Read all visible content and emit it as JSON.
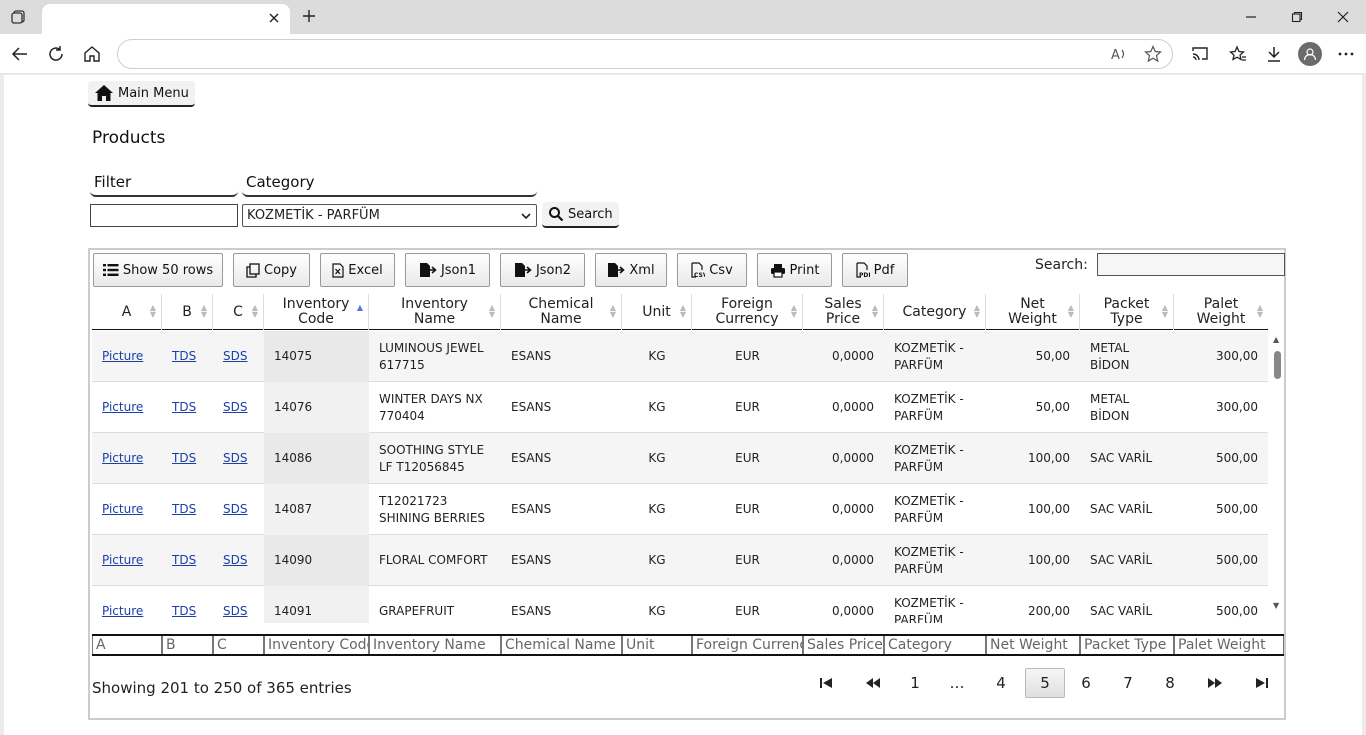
{
  "browser": {
    "tab_title": "",
    "url": ""
  },
  "page": {
    "main_menu_label": "Main Menu",
    "title": "Products",
    "filter_label": "Filter",
    "filter_value": "",
    "category_label": "Category",
    "category_value": "KOZMETİK - PARFÜM",
    "search_button_label": "Search"
  },
  "datatable": {
    "buttons": [
      "Show 50 rows",
      "Copy",
      "Excel",
      "Json1",
      "Json2",
      "Xml",
      "Csv",
      "Print",
      "Pdf"
    ],
    "search_label": "Search:",
    "search_value": "",
    "columns": [
      "A",
      "B",
      "C",
      "Inventory Code",
      "Inventory Name",
      "Chemical Name",
      "Unit",
      "Foreign Currency",
      "Sales Price",
      "Category",
      "Net Weight",
      "Packet Type",
      "Palet Weight"
    ],
    "header_lines": [
      [
        "A"
      ],
      [
        "B"
      ],
      [
        "C"
      ],
      [
        "Inventory",
        "Code"
      ],
      [
        "Inventory",
        "Name"
      ],
      [
        "Chemical",
        "Name"
      ],
      [
        "Unit"
      ],
      [
        "Foreign",
        "Currency"
      ],
      [
        "Sales",
        "Price"
      ],
      [
        "Category"
      ],
      [
        "Net",
        "Weight"
      ],
      [
        "Packet",
        "Type"
      ],
      [
        "Palet",
        "Weight"
      ]
    ],
    "sorted_column": "Inventory Code",
    "rows": [
      {
        "a": "Picture",
        "b": "TDS",
        "c": "SDS",
        "code": "14075",
        "name": "LUMINOUS JEWEL 617715",
        "chemical": "ESANS",
        "unit": "KG",
        "currency": "EUR",
        "price": "0,0000",
        "category": "KOZMETİK - PARFÜM",
        "net_weight": "50,00",
        "packet": "METAL BİDON",
        "palet_weight": "300,00"
      },
      {
        "a": "Picture",
        "b": "TDS",
        "c": "SDS",
        "code": "14076",
        "name": "WINTER DAYS NX 770404",
        "chemical": "ESANS",
        "unit": "KG",
        "currency": "EUR",
        "price": "0,0000",
        "category": "KOZMETİK - PARFÜM",
        "net_weight": "50,00",
        "packet": "METAL BİDON",
        "palet_weight": "300,00"
      },
      {
        "a": "Picture",
        "b": "TDS",
        "c": "SDS",
        "code": "14086",
        "name": "SOOTHING STYLE LF T12056845",
        "chemical": "ESANS",
        "unit": "KG",
        "currency": "EUR",
        "price": "0,0000",
        "category": "KOZMETİK - PARFÜM",
        "net_weight": "100,00",
        "packet": "SAC VARİL",
        "palet_weight": "500,00"
      },
      {
        "a": "Picture",
        "b": "TDS",
        "c": "SDS",
        "code": "14087",
        "name": "T12021723 SHINING BERRIES",
        "chemical": "ESANS",
        "unit": "KG",
        "currency": "EUR",
        "price": "0,0000",
        "category": "KOZMETİK - PARFÜM",
        "net_weight": "100,00",
        "packet": "SAC VARİL",
        "palet_weight": "500,00"
      },
      {
        "a": "Picture",
        "b": "TDS",
        "c": "SDS",
        "code": "14090",
        "name": "FLORAL COMFORT",
        "chemical": "ESANS",
        "unit": "KG",
        "currency": "EUR",
        "price": "0,0000",
        "category": "KOZMETİK - PARFÜM",
        "net_weight": "100,00",
        "packet": "SAC VARİL",
        "palet_weight": "500,00"
      },
      {
        "a": "Picture",
        "b": "TDS",
        "c": "SDS",
        "code": "14091",
        "name": "GRAPEFRUIT",
        "chemical": "ESANS",
        "unit": "KG",
        "currency": "EUR",
        "price": "0,0000",
        "category": "KOZMETİK - PARFÜM",
        "net_weight": "200,00",
        "packet": "SAC VARİL",
        "palet_weight": "500,00"
      }
    ],
    "footer_filters": [
      "A",
      "B",
      "C",
      "Inventory Code",
      "Inventory Name",
      "Chemical Name",
      "Unit",
      "Foreign Currency",
      "Sales Price",
      "Category",
      "Net Weight",
      "Packet Type",
      "Palet Weight"
    ],
    "info": "Showing 201 to 250 of 365 entries",
    "pages": [
      "1",
      "…",
      "4",
      "5",
      "6",
      "7",
      "8"
    ],
    "current_page": "5"
  }
}
